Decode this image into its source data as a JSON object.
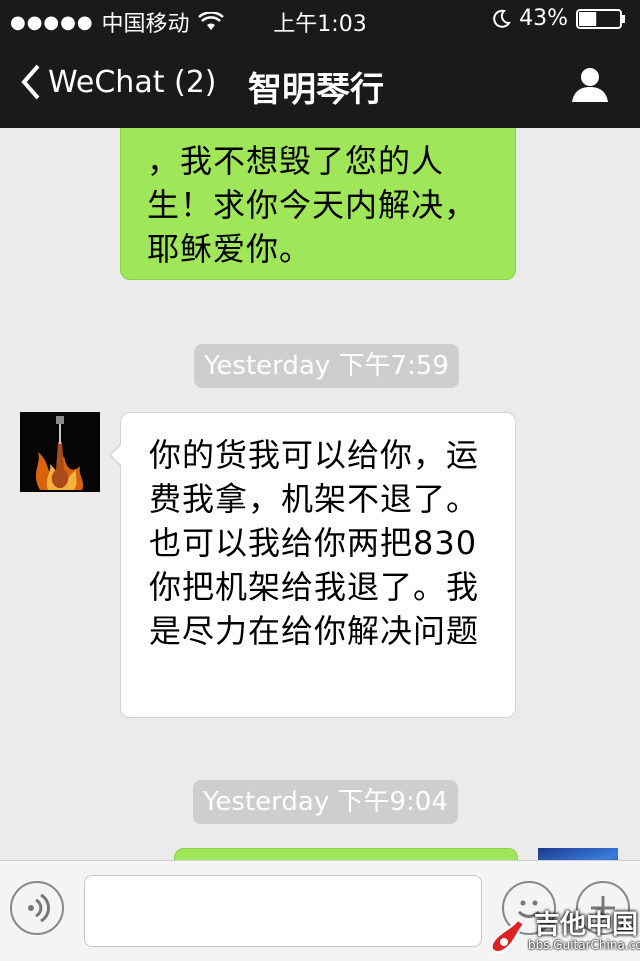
{
  "status_bar": {
    "signal_dots": "●●●●●",
    "carrier": "中国移动",
    "time": "上午1:03",
    "battery_percent": "43%",
    "battery_level": 0.43
  },
  "nav": {
    "back_label": "WeChat (2)",
    "title": "智明琴行"
  },
  "messages": [
    {
      "side": "right",
      "text": "，我不想毁了您的人生！求你今天内解决，耶稣爱你。"
    },
    {
      "timestamp": "Yesterday 下午7:59"
    },
    {
      "side": "left",
      "text": "你的货我可以给你，运费我拿，机架不退了。也可以我给你两把830你把机架给我退了。我是尽力在给你解决问题"
    },
    {
      "timestamp": "Yesterday 下午9:04"
    }
  ],
  "input": {
    "placeholder": ""
  },
  "watermark": {
    "name": "吉他中国",
    "url": "bbs.GuitarChina.com"
  },
  "colors": {
    "nav_bg": "#1a1a1a",
    "chat_bg": "#ebebeb",
    "sent_bubble": "#9fe658",
    "received_bubble": "#ffffff",
    "timestamp_bg": "#cecece"
  }
}
